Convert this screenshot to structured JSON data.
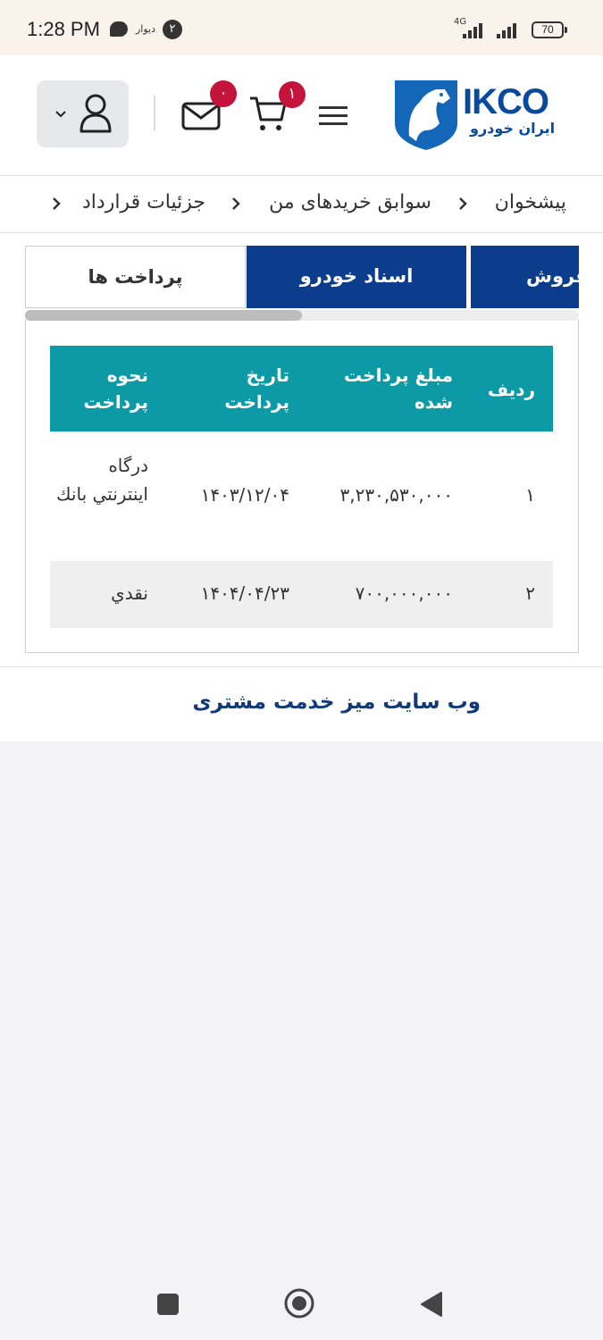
{
  "status_bar": {
    "time": "1:28 PM",
    "app_label": "دیوار",
    "notification_count": "۲",
    "network": "4G",
    "battery": "70"
  },
  "header": {
    "logo_text": "IKCO",
    "logo_subtext": "ایران خودرو",
    "mail_count": "۰",
    "cart_count": "۱",
    "icons": [
      "user-icon",
      "chevron-down-icon",
      "mail-icon",
      "cart-icon",
      "menu-icon"
    ]
  },
  "breadcrumb": {
    "items": [
      "پیشخوان",
      "سوابق خریدهای من",
      "جزئیات قرارداد"
    ]
  },
  "tabs": {
    "items": [
      "فروش",
      "اسناد خودرو",
      "پرداخت ها"
    ],
    "active": "پرداخت ها"
  },
  "table": {
    "headers": {
      "row": "ردیف",
      "amount": "مبلغ پرداخت شده",
      "date": "تاریخ پرداخت",
      "method": "نحوه پرداخت"
    },
    "rows": [
      {
        "row": "۱",
        "amount": "۳,۲۳۰,۵۳۰,۰۰۰",
        "date": "۱۴۰۳/۱۲/۰۴",
        "method": "درگاه اینترنتي بانك"
      },
      {
        "row": "۲",
        "amount": "۷۰۰,۰۰۰,۰۰۰",
        "date": "۱۴۰۴/۰۴/۲۳",
        "method": "نقدي"
      }
    ]
  },
  "footer": {
    "link": "وب سایت میز خدمت مشتری"
  },
  "colors": {
    "brand_blue": "#0b3d8c",
    "table_header": "#0b9aa6",
    "badge_red": "#c4143c",
    "link_blue": "#133a78"
  }
}
